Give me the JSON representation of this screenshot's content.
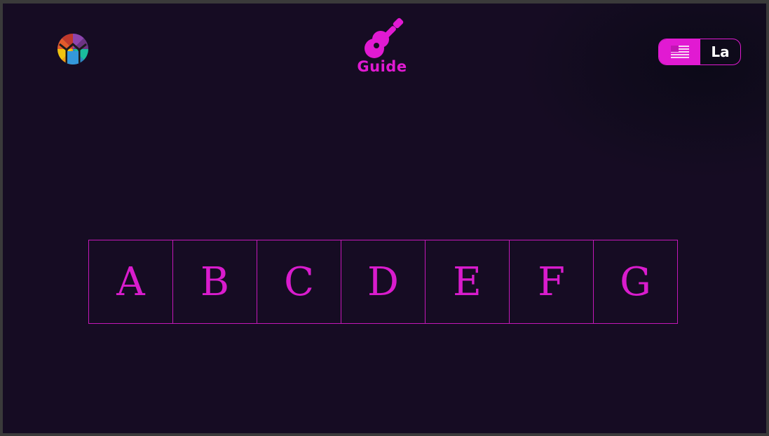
{
  "header": {
    "logo_icon": "multicolor-circle-logo",
    "guide": {
      "icon": "guitar-icon",
      "label": "Guide"
    },
    "language": {
      "flag_icon": "us-flag-icon",
      "code": "La"
    }
  },
  "notes": [
    "A",
    "B",
    "C",
    "D",
    "E",
    "F",
    "G"
  ],
  "colors": {
    "background": "#160c23",
    "accent": "#e11ad2",
    "note_border": "#c418b8"
  }
}
